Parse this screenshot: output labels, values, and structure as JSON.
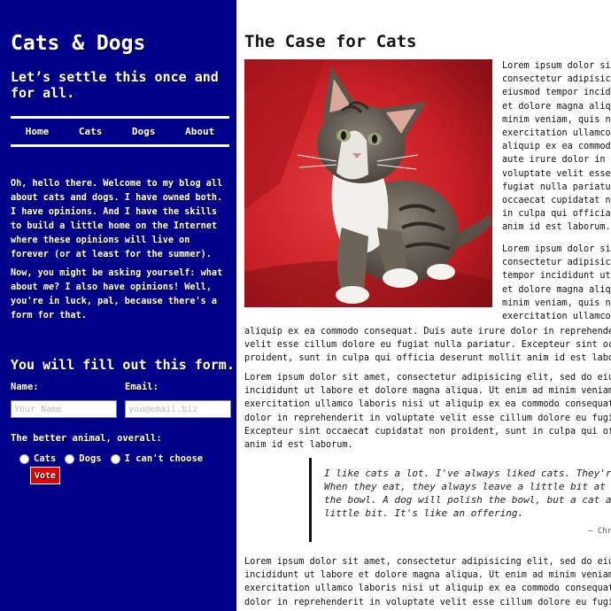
{
  "sidebar": {
    "site_title": "Cats & Dogs",
    "tagline": "Let’s settle this once and for all.",
    "nav": [
      "Home",
      "Cats",
      "Dogs",
      "About"
    ],
    "intro_p1": "Oh, hello there. Welcome to my blog all about cats and dogs. I have owned both. I have opinions. And I have the skills to build a little home on the Internet where these opinions will live on forever (or at least for the summer).",
    "intro_p2_before": "Now, you might be asking yourself: what about ",
    "intro_p2_em": "me",
    "intro_p2_after": "? I also have opinions! Well, you're in luck, pal, because there's a form for that.",
    "form": {
      "heading": "You will fill out this form.",
      "name_label": "Name:",
      "name_placeholder": "Your Name",
      "email_label": "Email:",
      "email_placeholder": "you@email.biz",
      "animal_label": "The better animal, overall:",
      "options": [
        "Cats",
        "Dogs",
        "I can't choose"
      ],
      "vote_label": "Vote"
    }
  },
  "main": {
    "title": "The Case for Cats",
    "image_subject": "kitten-on-red-chair",
    "wrap_lines": [
      "Lorem ipsum dolor sit amet,",
      "consectetur adipisicing elit, sed",
      "eiusmod tempor incididunt ut labore",
      "et dolore magna aliqua. Ut enim ad",
      "minim veniam, quis nostrud",
      "exercitation ullamco laboris nisi",
      "aliquip ex ea commodo consequat.",
      "aute irure dolor in reprehenderit",
      "voluptate velit esse cillum dolore",
      "fugiat nulla pariatur. Excepteur",
      "occaecat cupidatat non proident,",
      "in culpa qui officia deserunt",
      "anim id est laborum."
    ],
    "wrap_lines_2": [
      "Lorem ipsum dolor sit amet,",
      "consectetur adipisicing elit, sed",
      "tempor incididunt ut labore",
      "et dolore magna aliqua. Ut enim ad",
      "minim veniam, quis nostrud",
      "exercitation ullamco laboris nisi"
    ],
    "full_lines_1": [
      "aliquip ex ea commodo consequat. Duis aute irure dolor in reprehenderit in",
      "velit esse cillum dolore eu fugiat nulla pariatur. Excepteur sint occaecat",
      "proident, sunt in culpa qui officia deserunt mollit anim id est laborum."
    ],
    "full_lines_2": [
      "Lorem ipsum dolor sit amet, consectetur adipisicing elit, sed do eiusmod tempor",
      "incididunt ut labore et dolore magna aliqua. Ut enim ad minim veniam, quis",
      "exercitation ullamco laboris nisi ut aliquip ex ea commodo consequat. Duis aute",
      "dolor in reprehenderit in voluptate velit esse cillum dolore eu fugiat nulla",
      "Excepteur sint occaecat cupidatat non proident, sunt in culpa qui officia",
      "anim id est laborum."
    ],
    "quote_lines": [
      "I like cats a lot. I've always liked cats. They're great.",
      "When they eat, they always leave a little bit at the",
      "the bowl. A dog will polish the bowl, but a cat always leaves a",
      "little bit. It's like an offering."
    ],
    "quote_cite": "— Chr",
    "full_lines_3": [
      "Lorem ipsum dolor sit amet, consectetur adipisicing elit, sed do eiusmod tempor",
      "incididunt ut labore et dolore magna aliqua. Ut enim ad minim veniam, quis",
      "exercitation ullamco laboris nisi ut aliquip ex ea commodo consequat. Duis",
      "dolor in reprehenderit in voluptate velit esse cillum dolore eu fugiat nulla"
    ]
  },
  "colors": {
    "sidebar_bg": "#00008b",
    "vote_bg": "#e00000",
    "photo_red": "#d8242a"
  }
}
